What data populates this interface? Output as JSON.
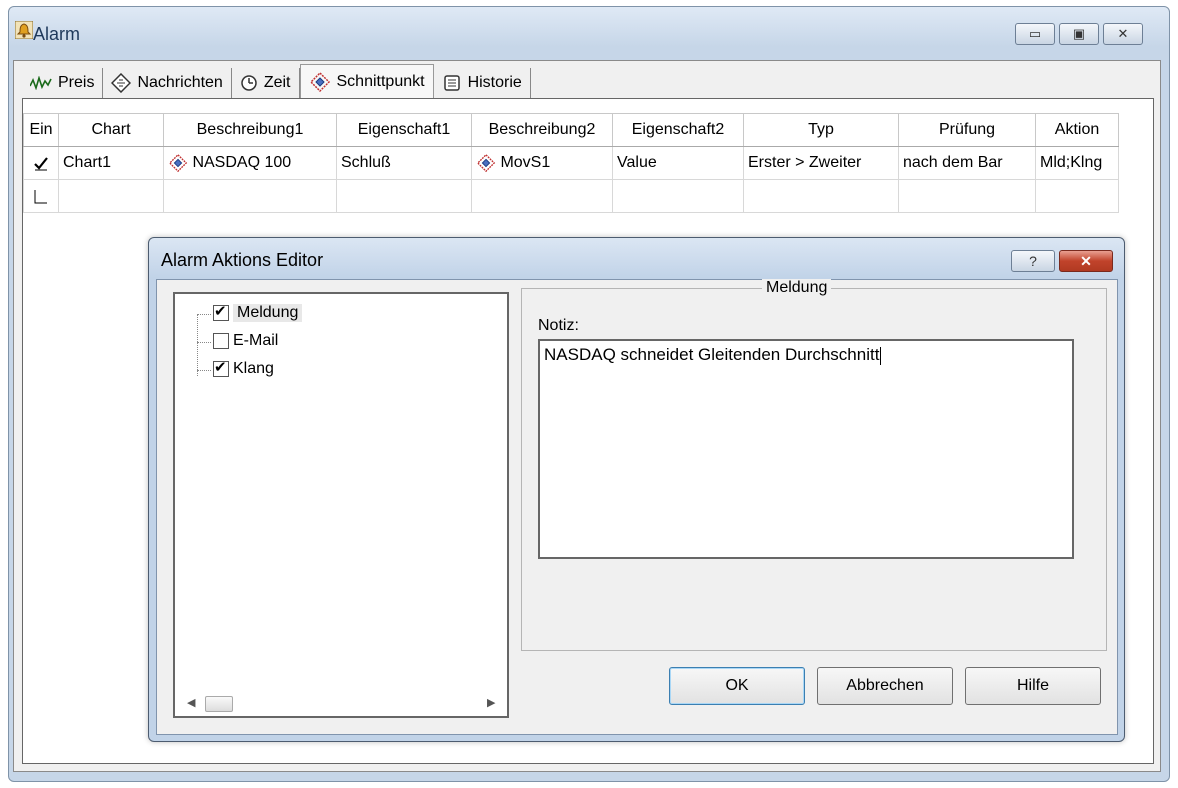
{
  "window": {
    "title": "Alarm",
    "controls": {
      "minimize": "▭",
      "maximize": "▣",
      "close": "✕"
    }
  },
  "tabs": [
    {
      "label": "Preis",
      "icon": "price-wave-icon"
    },
    {
      "label": "Nachrichten",
      "icon": "news-diamond-icon"
    },
    {
      "label": "Zeit",
      "icon": "clock-icon"
    },
    {
      "label": "Schnittpunkt",
      "icon": "crosshair-icon",
      "active": true
    },
    {
      "label": "Historie",
      "icon": "scroll-icon"
    }
  ],
  "grid": {
    "columns": [
      "Ein",
      "Chart",
      "Beschreibung1",
      "Eigenschaft1",
      "Beschreibung2",
      "Eigenschaft2",
      "Typ",
      "Prüfung",
      "Aktion"
    ],
    "rows": [
      {
        "enabled": true,
        "chart": "Chart1",
        "beschreibung1": "NASDAQ 100",
        "eigenschaft1": "Schluß",
        "beschreibung2": "MovS1",
        "eigenschaft2": "Value",
        "typ": "Erster > Zweiter",
        "pruefung": "nach dem Bar",
        "aktion": "Mld;Klng"
      },
      {
        "enabled": false,
        "chart": "",
        "beschreibung1": "",
        "eigenschaft1": "",
        "beschreibung2": "",
        "eigenschaft2": "",
        "typ": "",
        "pruefung": "",
        "aktion": ""
      }
    ]
  },
  "dialog": {
    "title": "Alarm Aktions Editor",
    "help_label": "?",
    "close_label": "✕",
    "tree": [
      {
        "label": "Meldung",
        "checked": true,
        "selected": true
      },
      {
        "label": "E-Mail",
        "checked": false
      },
      {
        "label": "Klang",
        "checked": true
      }
    ],
    "group_title": "Meldung",
    "notiz_label": "Notiz:",
    "notiz_value": "NASDAQ schneidet Gleitenden Durchschnitt",
    "buttons": {
      "ok": "OK",
      "cancel": "Abbrechen",
      "help": "Hilfe"
    }
  }
}
